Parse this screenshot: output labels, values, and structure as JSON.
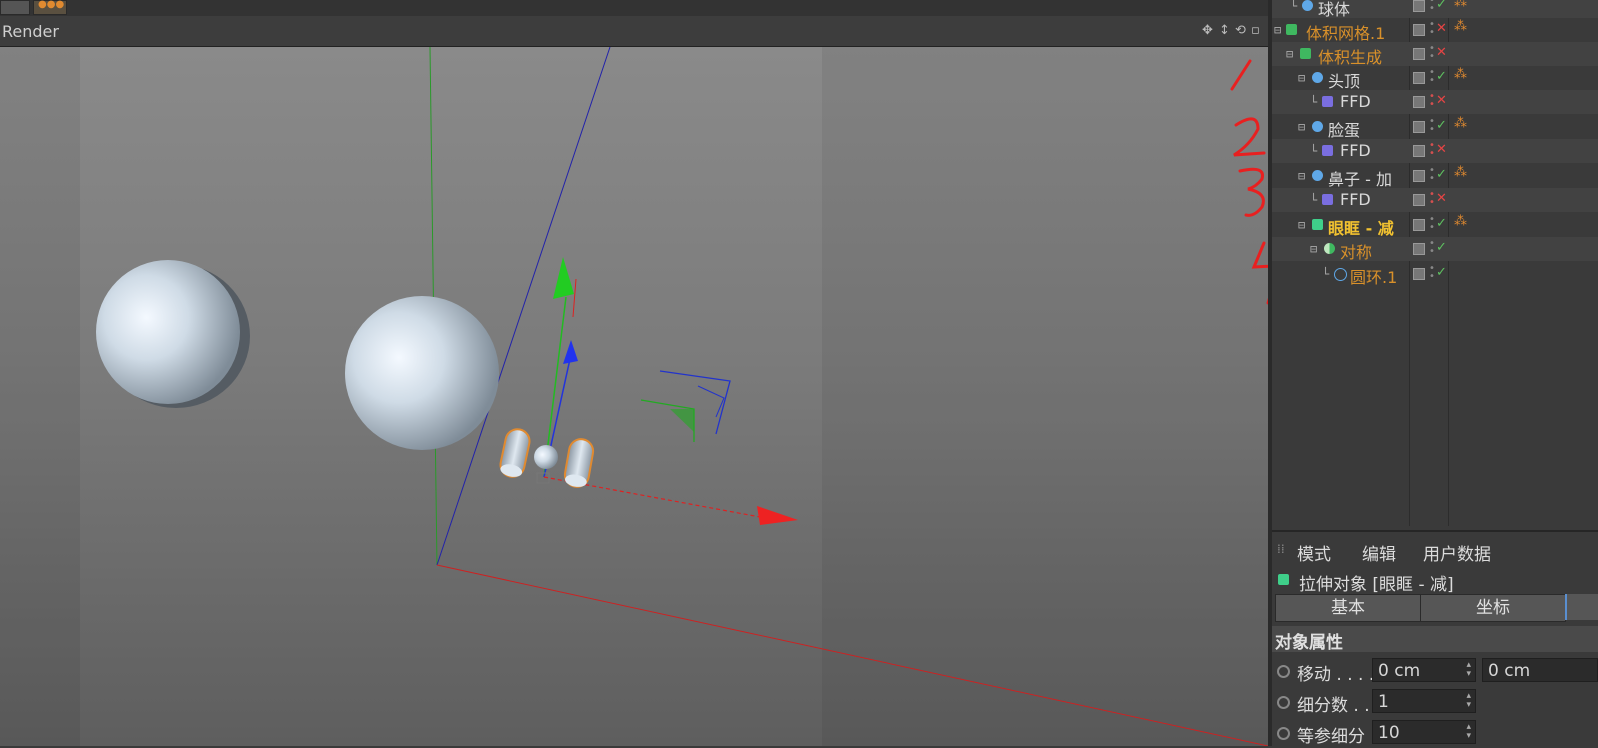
{
  "viewport": {
    "title": "Render",
    "annotations": [
      "1",
      "2",
      "3",
      "4"
    ]
  },
  "object_manager": {
    "rows": [
      {
        "label": "球体",
        "color": "white",
        "status": "ok",
        "tag": ""
      },
      {
        "label": "体积网格.1",
        "color": "orange",
        "status": "no",
        "tag": "tag"
      },
      {
        "label": "体积生成",
        "color": "orange",
        "status": "no",
        "tag": ""
      },
      {
        "label": "头顶",
        "color": "white",
        "status": "ok",
        "tag": "tag"
      },
      {
        "label": "FFD",
        "color": "white",
        "status": "no",
        "tag": ""
      },
      {
        "label": "脸蛋",
        "color": "white",
        "status": "ok",
        "tag": "tag"
      },
      {
        "label": "FFD",
        "color": "white",
        "status": "no",
        "tag": ""
      },
      {
        "label": "鼻子 - 加",
        "color": "white",
        "status": "ok",
        "tag": "tag"
      },
      {
        "label": "FFD",
        "color": "white",
        "status": "no",
        "tag": ""
      },
      {
        "label": "眼眶 -  减",
        "color": "yellow",
        "status": "ok",
        "tag": "tag"
      },
      {
        "label": "对称",
        "color": "orange",
        "status": "ok",
        "tag": ""
      },
      {
        "label": "圆环.1",
        "color": "orange",
        "status": "ok",
        "tag": ""
      }
    ]
  },
  "attribute_manager": {
    "menu": [
      "模式",
      "编辑",
      "用户数据"
    ],
    "object_title": "拉伸对象 [眼眶 -  减]",
    "tabs": [
      "基本",
      "坐标"
    ],
    "section": "对象属性",
    "properties": [
      {
        "label": "移动 . . . .",
        "value": "0 cm",
        "value2": "0 cm"
      },
      {
        "label": "细分数 . .",
        "value": "1"
      },
      {
        "label": "等参细分",
        "value": "10"
      }
    ]
  },
  "colors": {
    "accent_orange": "#d8902a",
    "accent_yellow": "#f2c230",
    "check_green": "#5ec060",
    "cross_red": "#e54444",
    "annotation_red": "#e82020"
  }
}
